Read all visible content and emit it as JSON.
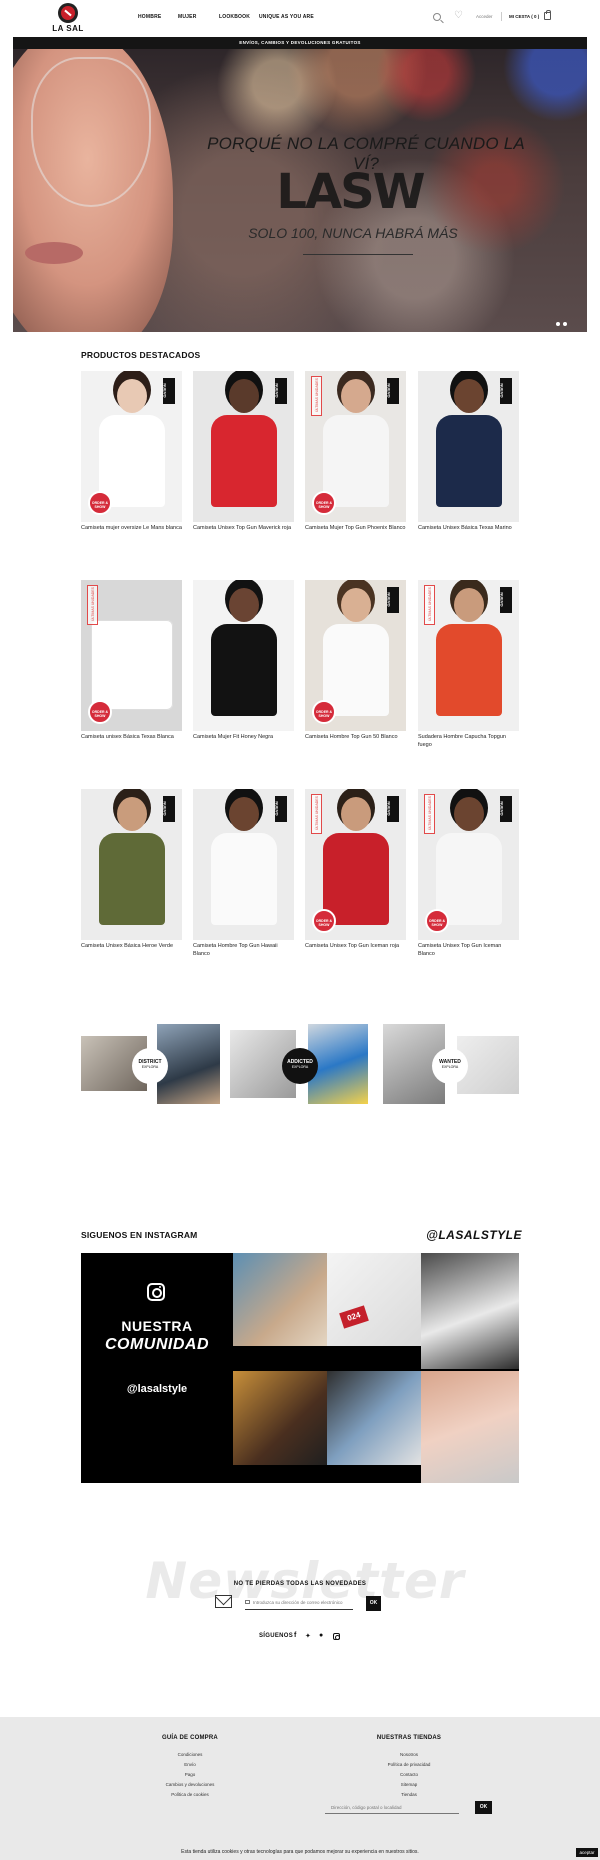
{
  "header": {
    "logo_text": "LA SAL",
    "nav": [
      "HOMBRE",
      "MUJER",
      "LOOKBOOK",
      "UNIQUE AS YOU ARE"
    ],
    "login_label": "Acceder",
    "cart_label": "MI CESTA ( 0 )"
  },
  "hero": {
    "banner": "ENVÍOS, CAMBIOS Y DEVOLUCIONES GRATUITOS",
    "question": "PORQUÉ NO LA COMPRÉ CUANDO LA VÍ?",
    "brand": "LASW",
    "subtitle": "SOLO 100, NUNCA HABRÁ MÁS"
  },
  "featured": {
    "title": "PRODUCTOS DESTACADOS",
    "tags": {
      "nuevo": "NUEVO",
      "ultimas": "ÚLTIMAS UNIDADES",
      "red": "ORDER & SHOW"
    },
    "products": [
      {
        "name": "Camiseta mujer oversize Le Mans blanca",
        "nuevo": true,
        "ultimas": false,
        "red": true
      },
      {
        "name": "Camiseta Unisex Top Gun Maverick roja",
        "nuevo": true,
        "ultimas": false,
        "red": false
      },
      {
        "name": "Camiseta Mujer Top Gun Phoenix Blanco",
        "nuevo": true,
        "ultimas": true,
        "red": true
      },
      {
        "name": "Camiseta Unisex Básica Texas Marino",
        "nuevo": true,
        "ultimas": false,
        "red": false
      },
      {
        "name": "Camiseta unisex Básica Texas Blanca",
        "nuevo": false,
        "ultimas": true,
        "red": true
      },
      {
        "name": "Camiseta Mujer Fit Honey Negra",
        "nuevo": false,
        "ultimas": false,
        "red": false
      },
      {
        "name": "Camiseta Hombre Top Gun 50 Blanco",
        "nuevo": true,
        "ultimas": false,
        "red": true
      },
      {
        "name": "Sudadera Hombre Capucha Topgun fuego",
        "nuevo": true,
        "ultimas": true,
        "red": false
      },
      {
        "name": "Camiseta Unisex Básica Heroe Verde",
        "nuevo": true,
        "ultimas": false,
        "red": false
      },
      {
        "name": "Camiseta Hombre Top Gun Hawaii Blanco",
        "nuevo": true,
        "ultimas": false,
        "red": false
      },
      {
        "name": "Camiseta Unisex Top Gun Iceman roja",
        "nuevo": true,
        "ultimas": true,
        "red": true
      },
      {
        "name": "Camiseta Unisex Top Gun Iceman Blanco",
        "nuevo": true,
        "ultimas": true,
        "red": true
      }
    ]
  },
  "categories": {
    "items": [
      {
        "label": "DISTRICT",
        "sub": "EXPLORA"
      },
      {
        "label": "ADDICTED",
        "sub": "EXPLORA"
      },
      {
        "label": "WANTED",
        "sub": "EXPLORA"
      }
    ]
  },
  "instagram": {
    "title": "SIGUENOS EN INSTAGRAM",
    "handle_title": "@LASALSTYLE",
    "community_1": "NUESTRA",
    "community_2": "COMUNIDAD",
    "handle": "@lasalstyle"
  },
  "newsletter": {
    "big_text": "Newsletter",
    "title": "NO TE PIERDAS TODAS LAS NOVEDADES",
    "placeholder": "Introduzca su dirección de correo electrónico",
    "ok": "OK",
    "follow": "SÍGUENOS"
  },
  "footer": {
    "col1_title": "GUÍA DE COMPRA",
    "col1_links": [
      "Condiciones",
      "Envío",
      "Pago",
      "Cambios y devoluciones",
      "Política de cookies"
    ],
    "col2_title": "NUESTRAS TIENDAS",
    "col2_links": [
      "Nosotros",
      "Política de privacidad",
      "Contacto",
      "Sitemap",
      "Tiendas"
    ],
    "store_placeholder": "Dirección, código postal o localidad",
    "ok": "OK"
  },
  "cookies": {
    "text": "Esta tienda utiliza cookies y otras tecnologías para que podamos mejorar su experiencia en nuestros sitios.",
    "button": "aceptar"
  },
  "colors": {
    "accent_red": "#d52b3a",
    "footer_bg": "#e9e9e9",
    "dark": "#111111"
  }
}
